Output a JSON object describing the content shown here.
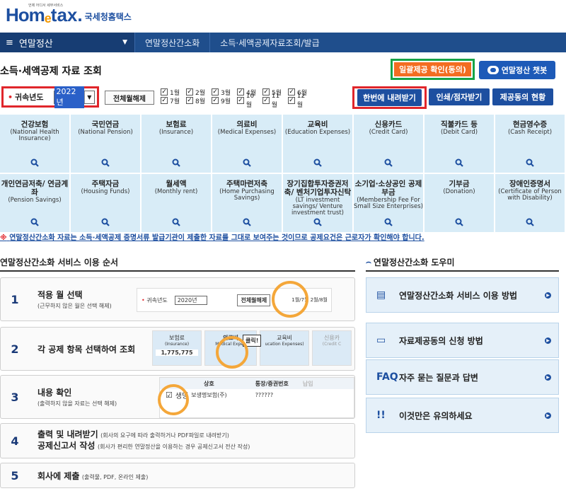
{
  "logo": {
    "home": "Hom",
    "e": "e",
    "tax": "tax.",
    "korean": "국세청홈택스",
    "sub": "언제 어디서 세무서비스"
  },
  "nav": {
    "menu_icon": "≡",
    "menu": "연말정산",
    "arrow": "▼",
    "crumb1": "연말정산간소화",
    "crumb2": "소득·세액공제자료조회/발급"
  },
  "page_title": "소득·세액공제 자료 조회",
  "buttons": {
    "consent": "일괄제공 확인(동의)",
    "chatbot": "연말정산 챗봇",
    "clear": "전체월해제",
    "download": "한번에 내려받기",
    "print": "인쇄/점자받기",
    "status": "제공동의 현황"
  },
  "filter": {
    "year_label": "귀속년도",
    "year": "2022년",
    "months_top": [
      "1월",
      "2월",
      "3월",
      "4월",
      "5월",
      "6월"
    ],
    "months_bottom": [
      "7월",
      "8월",
      "9월",
      "10월",
      "11월",
      "12월"
    ]
  },
  "categories": [
    [
      {
        "t": "건강보험",
        "e": "(National Health Insurance)"
      },
      {
        "t": "국민연금",
        "e": "(National Pension)"
      },
      {
        "t": "보험료",
        "e": "(Insurance)"
      },
      {
        "t": "의료비",
        "e": "(Medical Expenses)"
      },
      {
        "t": "교육비",
        "e": "(Education Expenses)"
      },
      {
        "t": "신용카드",
        "e": "(Credit Card)"
      },
      {
        "t": "직불카드 등",
        "e": "(Debit Card)"
      },
      {
        "t": "현금영수증",
        "e": "(Cash Receipt)"
      }
    ],
    [
      {
        "t": "개인연금저축/ 연금계좌",
        "e": "(Pension Savings)"
      },
      {
        "t": "주택자금",
        "e": "(Housing Funds)"
      },
      {
        "t": "월세액",
        "e": "(Monthly rent)"
      },
      {
        "t": "주택마련저축",
        "e": "(Home Purchasing Savings)"
      },
      {
        "t": "장기집합투자증권저축/ 벤처기업투자신탁",
        "e": "(LT investment savings/ Venture investment trust)"
      },
      {
        "t": "소기업·소상공인 공제부금",
        "e": "(Membership Fee For Small Size Enterprises)"
      },
      {
        "t": "기부금",
        "e": "(Donation)"
      },
      {
        "t": "장애인증명서",
        "e": "(Certificate of Person with Disability)"
      }
    ]
  ],
  "notice": {
    "star": "※",
    "text": "연말정산간소화 자료는 소득·세액공제 증명서류 발급기관이 제출한 자료를 그대로 보여주는 것이므로 공제요건은 근로자가 확인해야 합니다."
  },
  "steps_title": "연말정산간소화 서비스 이용 순서",
  "steps": [
    {
      "n": "1",
      "t": "적용 월 선택",
      "s": "(근무하지 않은 월은 선택 해제)"
    },
    {
      "n": "2",
      "t": "각 공제 항목 선택하여 조회",
      "s": ""
    },
    {
      "n": "3",
      "t": "내용 확인",
      "s": "(출력하지 않을 자료는 선택 해제)"
    },
    {
      "n": "4",
      "t": "출력 및 내려받기",
      "t2": "공제신고서 작성",
      "s": "(회사의 요구에 따라 출력하거나 PDF파일로 내려받기)",
      "s2": "(회사가 편리한 연말정산을 이용하는 경우 공제신고서 전산 작성)"
    },
    {
      "n": "5",
      "t": "회사에 제출",
      "s": "(출력물, PDF, 온라인 제출)"
    }
  ],
  "insets": {
    "year_label": "귀속년도",
    "year": "2020년",
    "clear": "전체월해제",
    "m1": "1월",
    "m2": "2월",
    "m7": "7월",
    "m8": "8월",
    "cat1_t": "보험료",
    "cat1_e": "(Insurance)",
    "cat1_v": "1,775,775",
    "cat2_t": "의료비",
    "cat2_e": "Medical Expen",
    "click": "클릭!",
    "cat3_t": "교육비",
    "cat3_e": "ucation Expenses)",
    "cat4_t": "신용카",
    "cat4_e": "(Credit C",
    "col_name": "상호",
    "col_num": "통장/증권번호",
    "col_x": "납입",
    "row_name": "보생명보험(주)",
    "row_num": "??????",
    "check_text": "생명"
  },
  "help_title": "연말정산간소화 도우미",
  "help": [
    {
      "icon": "doc-pen-icon",
      "label": "연말정산간소화 서비스 이용 방법",
      "glyph": "▤"
    },
    {
      "icon": "doc-icon",
      "label": "자료제공동의 신청 방법",
      "glyph": "▭"
    },
    {
      "icon": "faq-icon",
      "label": "자주 묻는 질문과 답변",
      "glyph": "FAQ"
    },
    {
      "icon": "exclamation-icon",
      "label": "이것만은 유의하세요",
      "glyph": "!!"
    }
  ],
  "colors": {
    "nav": "#1f4e8c",
    "accent_orange": "#f36d21",
    "highlight_red": "#e0262b",
    "highlight_green": "#17a347",
    "tile": "#d8ecf7"
  }
}
